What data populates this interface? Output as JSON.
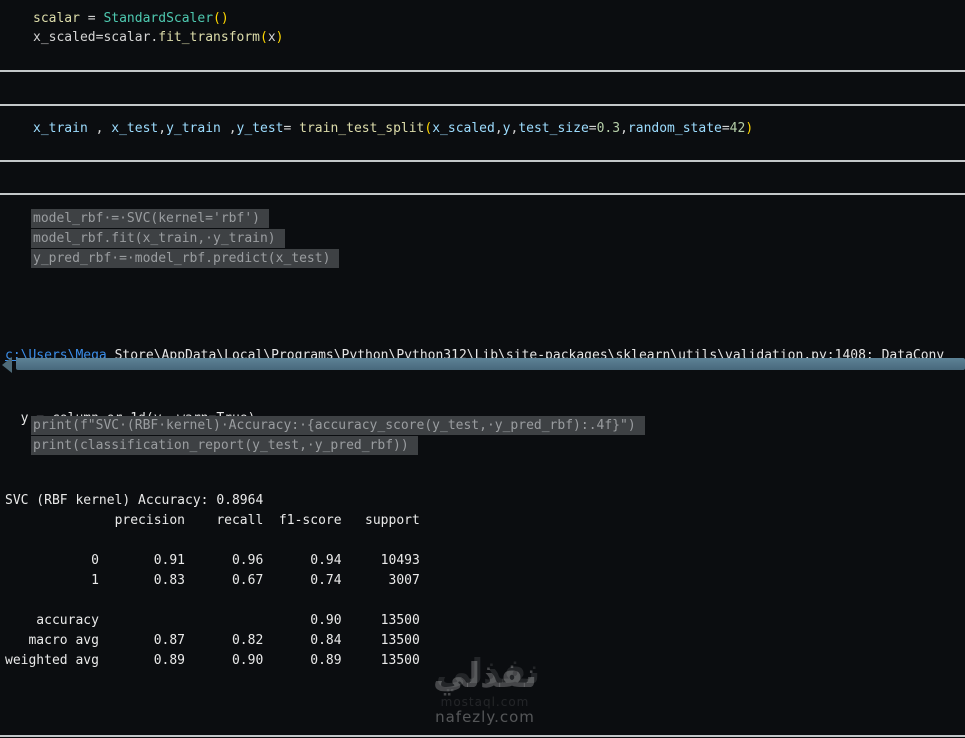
{
  "cells": {
    "cell1": {
      "lines": [
        [
          {
            "t": "scalar",
            "c": "fn"
          },
          {
            "t": " = ",
            "c": "pl"
          },
          {
            "t": "StandardScaler",
            "c": "cls"
          },
          {
            "t": "()",
            "c": "au"
          }
        ],
        [
          {
            "t": "x_scaled",
            "c": "pl"
          },
          {
            "t": "=",
            "c": "pl"
          },
          {
            "t": "scalar",
            "c": "pl"
          },
          {
            "t": ".",
            "c": "pl"
          },
          {
            "t": "fit_transform",
            "c": "fn"
          },
          {
            "t": "(",
            "c": "au"
          },
          {
            "t": "x",
            "c": "pl"
          },
          {
            "t": ")",
            "c": "au"
          }
        ]
      ]
    },
    "cell2": {
      "lines": [
        [
          {
            "t": "x_train ",
            "c": "v"
          },
          {
            "t": ", ",
            "c": "pl"
          },
          {
            "t": "x_test",
            "c": "v"
          },
          {
            "t": ",",
            "c": "pl"
          },
          {
            "t": "y_train ",
            "c": "v"
          },
          {
            "t": ",",
            "c": "pl"
          },
          {
            "t": "y_test",
            "c": "v"
          },
          {
            "t": "= ",
            "c": "pl"
          },
          {
            "t": "train_test_split",
            "c": "fn"
          },
          {
            "t": "(",
            "c": "au"
          },
          {
            "t": "x_scaled",
            "c": "v"
          },
          {
            "t": ",",
            "c": "pl"
          },
          {
            "t": "y",
            "c": "v"
          },
          {
            "t": ",",
            "c": "pl"
          },
          {
            "t": "test_size",
            "c": "v"
          },
          {
            "t": "=",
            "c": "pl"
          },
          {
            "t": "0.3",
            "c": "num"
          },
          {
            "t": ",",
            "c": "pl"
          },
          {
            "t": "random_state",
            "c": "v"
          },
          {
            "t": "=",
            "c": "pl"
          },
          {
            "t": "42",
            "c": "num"
          },
          {
            "t": ")",
            "c": "au"
          }
        ]
      ]
    },
    "cell3": {
      "selected_lines": [
        "model_rbf·=·SVC(kernel='rbf')",
        "model_rbf.fit(x_train,·y_train)",
        "y_pred_rbf·=·model_rbf.predict(x_test)"
      ]
    },
    "cell4": {
      "selected_lines": [
        "print(f\"SVC·(RBF·kernel)·Accuracy:·{accuracy_score(y_test,·y_pred_rbf):.4f}\")",
        "print(classification_report(y_test,·y_pred_rbf))"
      ]
    }
  },
  "warning": {
    "link": "c:\\Users\\Mega",
    "rest": " Store\\AppData\\Local\\Programs\\Python\\Python312\\Lib\\site-packages\\sklearn\\utils\\validation.py:1408: DataConv",
    "line2": "  y = column_or_1d(y, warn=True)"
  },
  "output": {
    "lines": [
      "SVC (RBF kernel) Accuracy: 0.8964",
      "              precision    recall  f1-score   support",
      "",
      "           0       0.91      0.96      0.94     10493",
      "           1       0.83      0.67      0.74      3007",
      "",
      "    accuracy                           0.90     13500",
      "   macro avg       0.87      0.82      0.84     13500",
      "weighted avg       0.89      0.90      0.89     13500"
    ]
  },
  "watermark": {
    "arabic": "نفذلي",
    "site_faint": "mostaql.com",
    "site": "nafezly.com"
  },
  "colors": {
    "background": "#0b0d10",
    "divider": "#c3c7c9",
    "plain_code": "#d4d4d4",
    "variable": "#9cdcfe",
    "function": "#dcdcaa",
    "class_name": "#4ec9b0",
    "number": "#b5cea8",
    "bracket": "#ffd700",
    "selection_bg": "#3e4144",
    "selection_text": "#9a9da0",
    "link": "#3b8eea",
    "scrollbar": "#52788b"
  }
}
